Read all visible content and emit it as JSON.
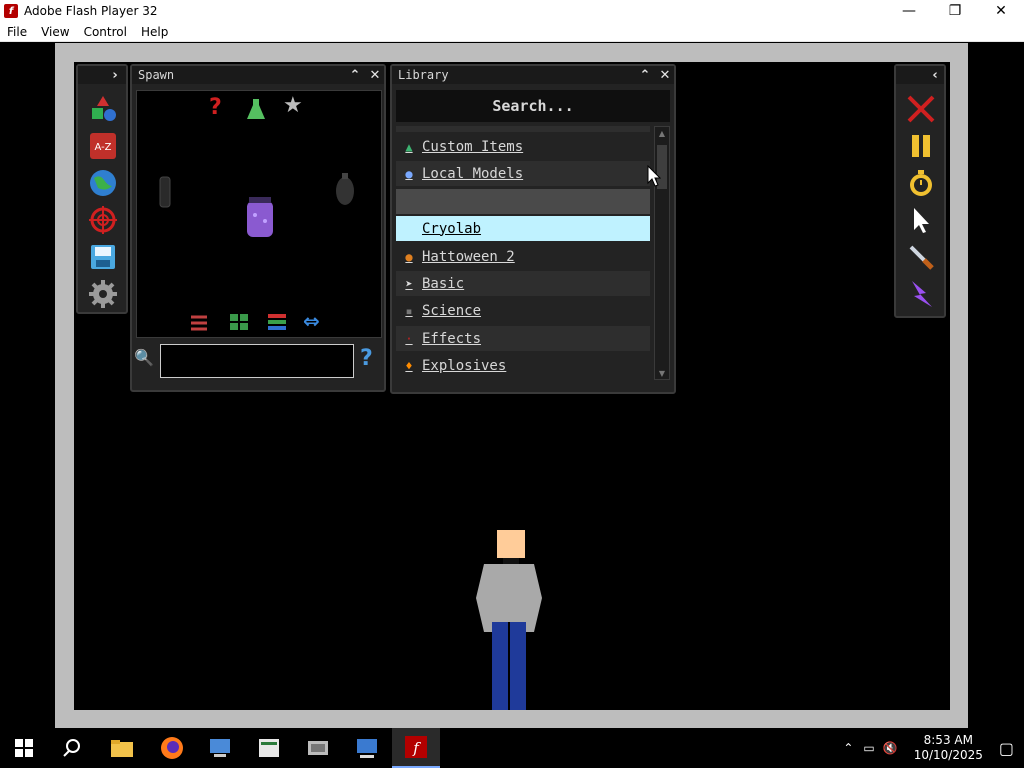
{
  "window": {
    "title": "Adobe Flash Player 32",
    "minimize": "—",
    "restore": "❐",
    "close": "✕"
  },
  "menu": [
    "File",
    "View",
    "Control",
    "Help"
  ],
  "spawn": {
    "title": "Spawn",
    "search_value": "",
    "help": "?"
  },
  "library": {
    "title": "Library",
    "search_label": "Search...",
    "items": [
      {
        "label": "Custom Items",
        "icon": "tree-icon",
        "icon_color": "#3cb371"
      },
      {
        "label": "Local Models",
        "icon": "dot-icon",
        "icon_color": "#7aa9ff"
      },
      {
        "label": "",
        "icon": "",
        "icon_color": ""
      },
      {
        "label": "Cryolab",
        "icon": "",
        "icon_color": "#9fdfff"
      },
      {
        "label": "Hattoween 2",
        "icon": "pumpkin-icon",
        "icon_color": "#e08020"
      },
      {
        "label": "Basic",
        "icon": "cursor-icon",
        "icon_color": "#dddddd"
      },
      {
        "label": "Science",
        "icon": "chip-icon",
        "icon_color": "#777777"
      },
      {
        "label": "Effects",
        "icon": "spark-icon",
        "icon_color": "#cc2222"
      },
      {
        "label": "Explosives",
        "icon": "fire-icon",
        "icon_color": "#ff8c00"
      }
    ],
    "selected_index": 3,
    "hover_index": 2
  },
  "taskbar": {
    "time": "8:53 AM",
    "date": "10/10/2025"
  },
  "colors": {
    "panel_bg": "#232323",
    "selection": "#bff2ff",
    "hover": "#4a4a4a"
  }
}
